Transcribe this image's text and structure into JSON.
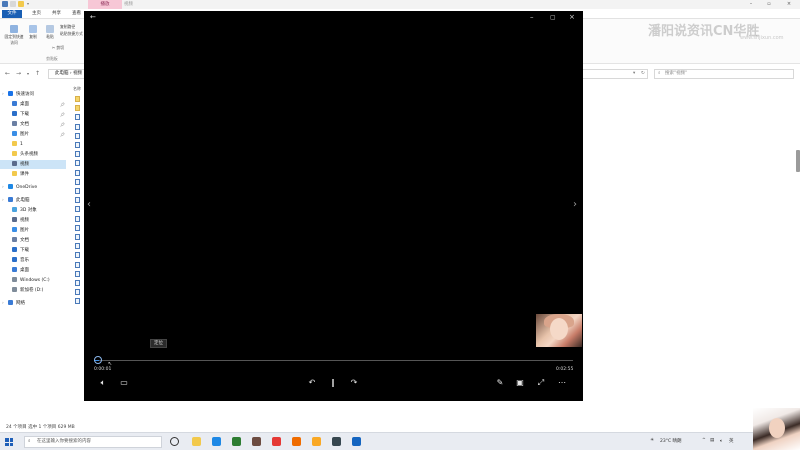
{
  "explorer": {
    "title_bar": {
      "context_tab": "播放",
      "context_tab2": "视频"
    },
    "ribbon_tabs": [
      "文件",
      "主页",
      "共享",
      "查看"
    ],
    "ribbon": {
      "pin_label": "固定到快速访问",
      "copy_label": "复制",
      "paste_label": "粘贴",
      "cut_label": "剪切",
      "copy_path_label": "复制路径",
      "paste_shortcut_label": "粘贴快捷方式",
      "clipboard_group": "剪贴板"
    },
    "address": {
      "path": "此电脑  ›  视频",
      "search_placeholder": "搜索\"视频\""
    },
    "sidebar": {
      "items": [
        {
          "label": "快速访问",
          "icon": "star-icon",
          "color": "#1a73e8"
        },
        {
          "label": "桌面",
          "icon": "desktop-icon",
          "color": "#3a7bd5"
        },
        {
          "label": "下载",
          "icon": "download-icon",
          "color": "#2b6fc9"
        },
        {
          "label": "文档",
          "icon": "document-icon",
          "color": "#6b7fa3"
        },
        {
          "label": "图片",
          "icon": "picture-icon",
          "color": "#3a8ee6"
        },
        {
          "label": "1",
          "icon": "folder-icon",
          "color": "#f2c94c"
        },
        {
          "label": "头条视频",
          "icon": "folder-icon",
          "color": "#f2c94c"
        },
        {
          "label": "视频",
          "icon": "video-icon",
          "color": "#5a6b8c"
        },
        {
          "label": "课件",
          "icon": "folder-icon",
          "color": "#f2c94c"
        },
        {
          "label": "OneDrive",
          "icon": "cloud-icon",
          "color": "#1e88e5"
        },
        {
          "label": "此电脑",
          "icon": "computer-icon",
          "color": "#3a7bd5"
        },
        {
          "label": "3D 对象",
          "icon": "cube-icon",
          "color": "#4aa3df"
        },
        {
          "label": "视频",
          "icon": "video-icon",
          "color": "#5a6b8c"
        },
        {
          "label": "图片",
          "icon": "picture-icon",
          "color": "#3a8ee6"
        },
        {
          "label": "文档",
          "icon": "document-icon",
          "color": "#6b7fa3"
        },
        {
          "label": "下载",
          "icon": "download-icon",
          "color": "#2b6fc9"
        },
        {
          "label": "音乐",
          "icon": "music-icon",
          "color": "#2b6fc9"
        },
        {
          "label": "桌面",
          "icon": "desktop-icon",
          "color": "#3a7bd5"
        },
        {
          "label": "Windows (C:)",
          "icon": "drive-icon",
          "color": "#7f8c9a"
        },
        {
          "label": "新加卷 (D:)",
          "icon": "drive-icon",
          "color": "#7f8c9a"
        },
        {
          "label": "网络",
          "icon": "network-icon",
          "color": "#3a7bd5"
        }
      ]
    },
    "column_header": "名称",
    "status_text": "24 个项目   选中 1 个项目  629 MB"
  },
  "watermark": {
    "text": "潘阳说资讯CN",
    "brand": "华胜",
    "sub": "www.shjixun.com"
  },
  "player": {
    "tooltip": "定位",
    "current_time": "0:00:01",
    "total_time": "0:02:55",
    "progress": 0.01
  },
  "taskbar": {
    "search_placeholder": "在这里输入你要搜索的内容",
    "apps": [
      "task-view-icon",
      "files-icon",
      "edge-icon",
      "app-icon",
      "app-icon",
      "app-icon",
      "app-icon",
      "app-icon",
      "app-icon",
      "app-icon"
    ],
    "weather": "23°C 晴朗",
    "ime": "英",
    "time": "",
    "colors": {
      "start": "#1f5fb8"
    }
  }
}
